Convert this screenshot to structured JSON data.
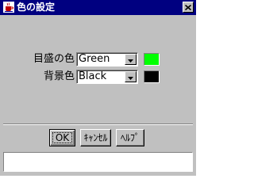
{
  "window": {
    "title": "色の設定",
    "icon": "java-cup-icon",
    "close_icon": "close-icon"
  },
  "rows": [
    {
      "label": "目盛の色",
      "selected": "Green",
      "swatch_color": "#00ff00"
    },
    {
      "label": "背景色",
      "selected": "Black",
      "swatch_color": "#000000"
    }
  ],
  "buttons": {
    "ok": "OK",
    "cancel": "ｷｬﾝｾﾙ",
    "help": "ﾍﾙﾌﾟ"
  },
  "status": {
    "text": ""
  }
}
